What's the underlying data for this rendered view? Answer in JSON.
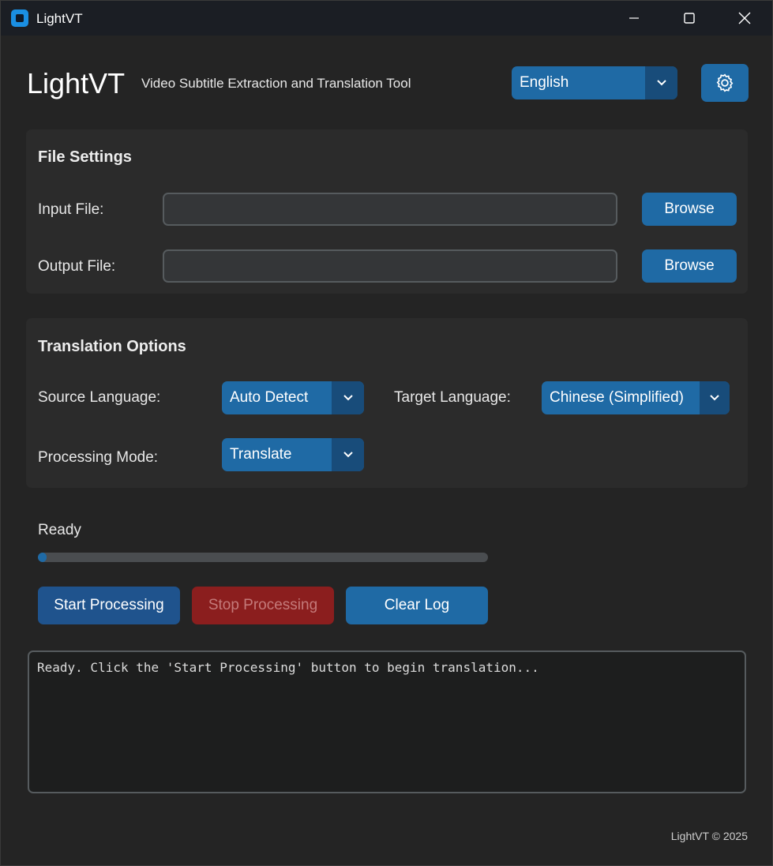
{
  "window": {
    "title": "LightVT"
  },
  "header": {
    "brand": "LightVT",
    "subtitle": "Video Subtitle Extraction and Translation Tool",
    "ui_language": "English"
  },
  "file_settings": {
    "title": "File Settings",
    "input_label": "Input File:",
    "input_value": "",
    "output_label": "Output File:",
    "output_value": "",
    "browse_label": "Browse"
  },
  "translation_options": {
    "title": "Translation Options",
    "source_label": "Source Language:",
    "source_value": "Auto Detect",
    "target_label": "Target Language:",
    "target_value": "Chinese (Simplified)",
    "mode_label": "Processing Mode:",
    "mode_value": "Translate"
  },
  "progress": {
    "status": "Ready",
    "fraction": 0.02
  },
  "actions": {
    "start": "Start Processing",
    "stop": "Stop Processing",
    "clear": "Clear Log"
  },
  "log": {
    "text": "Ready. Click the 'Start Processing' button to begin translation..."
  },
  "footer": {
    "text": "LightVT © 2025"
  },
  "colors": {
    "accent": "#1f6aa5",
    "accent_dark": "#184c7a",
    "stop": "#8b1e1e",
    "panel": "#2b2b2b"
  },
  "icons": [
    "app-icon",
    "minimize-icon",
    "maximize-icon",
    "close-icon",
    "chevron-down-icon",
    "gear-icon"
  ]
}
